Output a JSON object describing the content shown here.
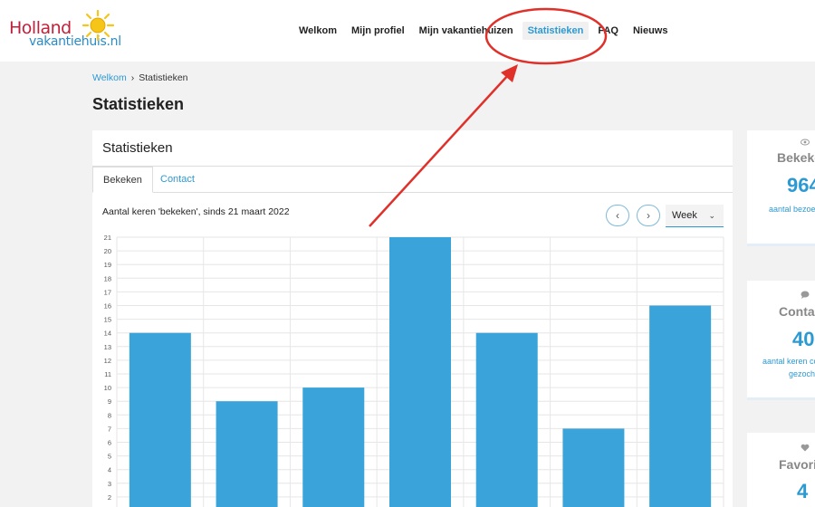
{
  "logo": {
    "holland": "Holland",
    "vakantiehuis": "vakantiehuis.nl"
  },
  "nav": [
    {
      "label": "Welkom"
    },
    {
      "label": "Mijn profiel"
    },
    {
      "label": "Mijn vakantiehuizen"
    },
    {
      "label": "Statistieken"
    },
    {
      "label": "FAQ"
    },
    {
      "label": "Nieuws"
    }
  ],
  "breadcrumb": {
    "home": "Welkom",
    "separator": "›",
    "current": "Statistieken"
  },
  "page_title": "Statistieken",
  "card": {
    "title": "Statistieken",
    "tabs": [
      {
        "label": "Bekeken"
      },
      {
        "label": "Contact"
      }
    ],
    "caption": "Aantal keren 'bekeken', sinds 21 maart 2022",
    "prev_icon": "‹",
    "next_icon": "›",
    "period": "Week"
  },
  "chart_data": {
    "type": "bar",
    "values": [
      14,
      9,
      10,
      21,
      14,
      7,
      16
    ],
    "ylim": [
      0,
      21
    ],
    "yticks": [
      2,
      3,
      4,
      5,
      6,
      7,
      8,
      9,
      10,
      11,
      12,
      13,
      14,
      15,
      16,
      17,
      18,
      19,
      20,
      21
    ],
    "bar_color": "#3aa3d9",
    "grid": true
  },
  "side": [
    {
      "icon": "eye-icon",
      "label": "Bekeken",
      "value": "964",
      "desc": "aantal bezoekers"
    },
    {
      "icon": "chat-icon",
      "label": "Contact",
      "value": "40",
      "desc_line1": "aantal keren contact",
      "desc_line2": "gezocht"
    },
    {
      "icon": "heart-icon",
      "label": "Favoriet",
      "value": "4"
    }
  ],
  "colors": {
    "accent": "#2b9ad3",
    "annotation": "#e0302a",
    "logo_red": "#c0203a"
  }
}
